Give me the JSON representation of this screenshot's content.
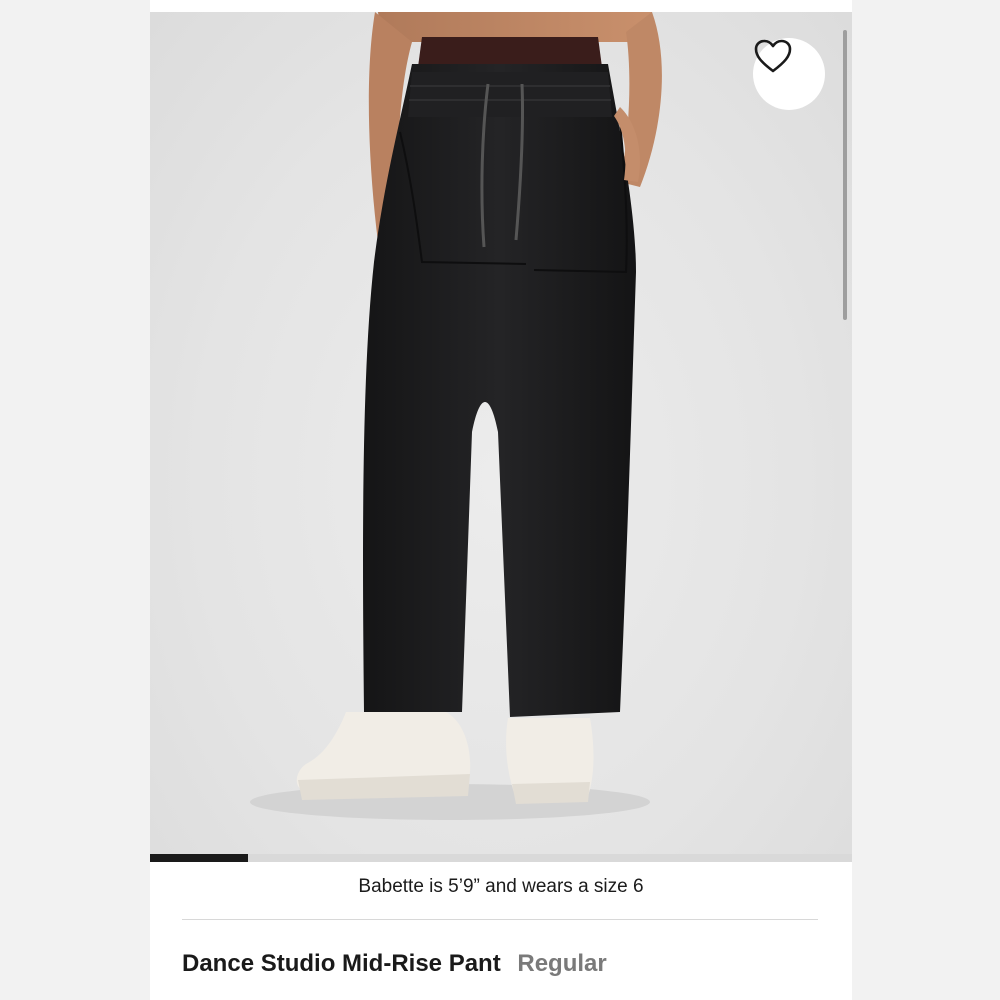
{
  "product": {
    "name": "Dance Studio Mid-Rise Pant",
    "fit": "Regular",
    "model_note": "Babette is 5’9” and wears a size 6"
  },
  "gallery": {
    "image_alt": "Woman wearing black Dance Studio Mid-Rise Pant with white sneakers",
    "progress_fraction": 0.14
  },
  "icons": {
    "wishlist": "heart-outline-icon"
  },
  "colors": {
    "pant": "#1f1f20",
    "waistband": "#3a1d1b",
    "background": "#e6e6e6",
    "progress": "#1a1a1a"
  }
}
